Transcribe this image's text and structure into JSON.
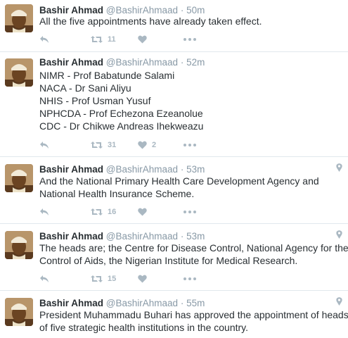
{
  "tweets": [
    {
      "name": "Bashir Ahmad",
      "handle": "@BashirAhmaad",
      "separator": "·",
      "time": "50m",
      "lines": [
        "All the five appointments have already taken effect."
      ],
      "retweets": "11",
      "likes": ""
    },
    {
      "name": "Bashir Ahmad",
      "handle": "@BashirAhmaad",
      "separator": "·",
      "time": "52m",
      "lines": [
        "NIMR - Prof Babatunde Salami",
        "NACA - Dr Sani Aliyu",
        "NHIS - Prof Usman Yusuf",
        "NPHCDA - Prof Echezona Ezeanolue",
        "CDC - Dr Chikwe Andreas Ihekweazu"
      ],
      "retweets": "31",
      "likes": "2"
    },
    {
      "name": "Bashir Ahmad",
      "handle": "@BashirAhmaad",
      "separator": "·",
      "time": "53m",
      "lines": [
        "And the National Primary Health Care Development Agency and",
        "National Health Insurance Scheme."
      ],
      "retweets": "16",
      "likes": ""
    },
    {
      "name": "Bashir Ahmad",
      "handle": "@BashirAhmaad",
      "separator": "·",
      "time": "53m",
      "lines": [
        "The heads are; the Centre for Disease Control, National Agency for the",
        "Control of Aids, the Nigerian Institute for Medical Research."
      ],
      "retweets": "15",
      "likes": ""
    },
    {
      "name": "Bashir Ahmad",
      "handle": "@BashirAhmaad",
      "separator": "·",
      "time": "55m",
      "lines": [
        "President Muhammadu Buhari has approved the appointment of heads",
        "of five strategic health institutions in the country."
      ],
      "retweets": "",
      "likes": ""
    }
  ],
  "icons": {
    "reply": "reply-icon",
    "retweet": "retweet-icon",
    "like": "heart-icon",
    "more": "more-icon",
    "location": "location-pin-icon"
  },
  "colors": {
    "name": "#292f33",
    "meta": "#8899a6",
    "action": "#aab8c2",
    "divider": "#e1e8ed"
  }
}
